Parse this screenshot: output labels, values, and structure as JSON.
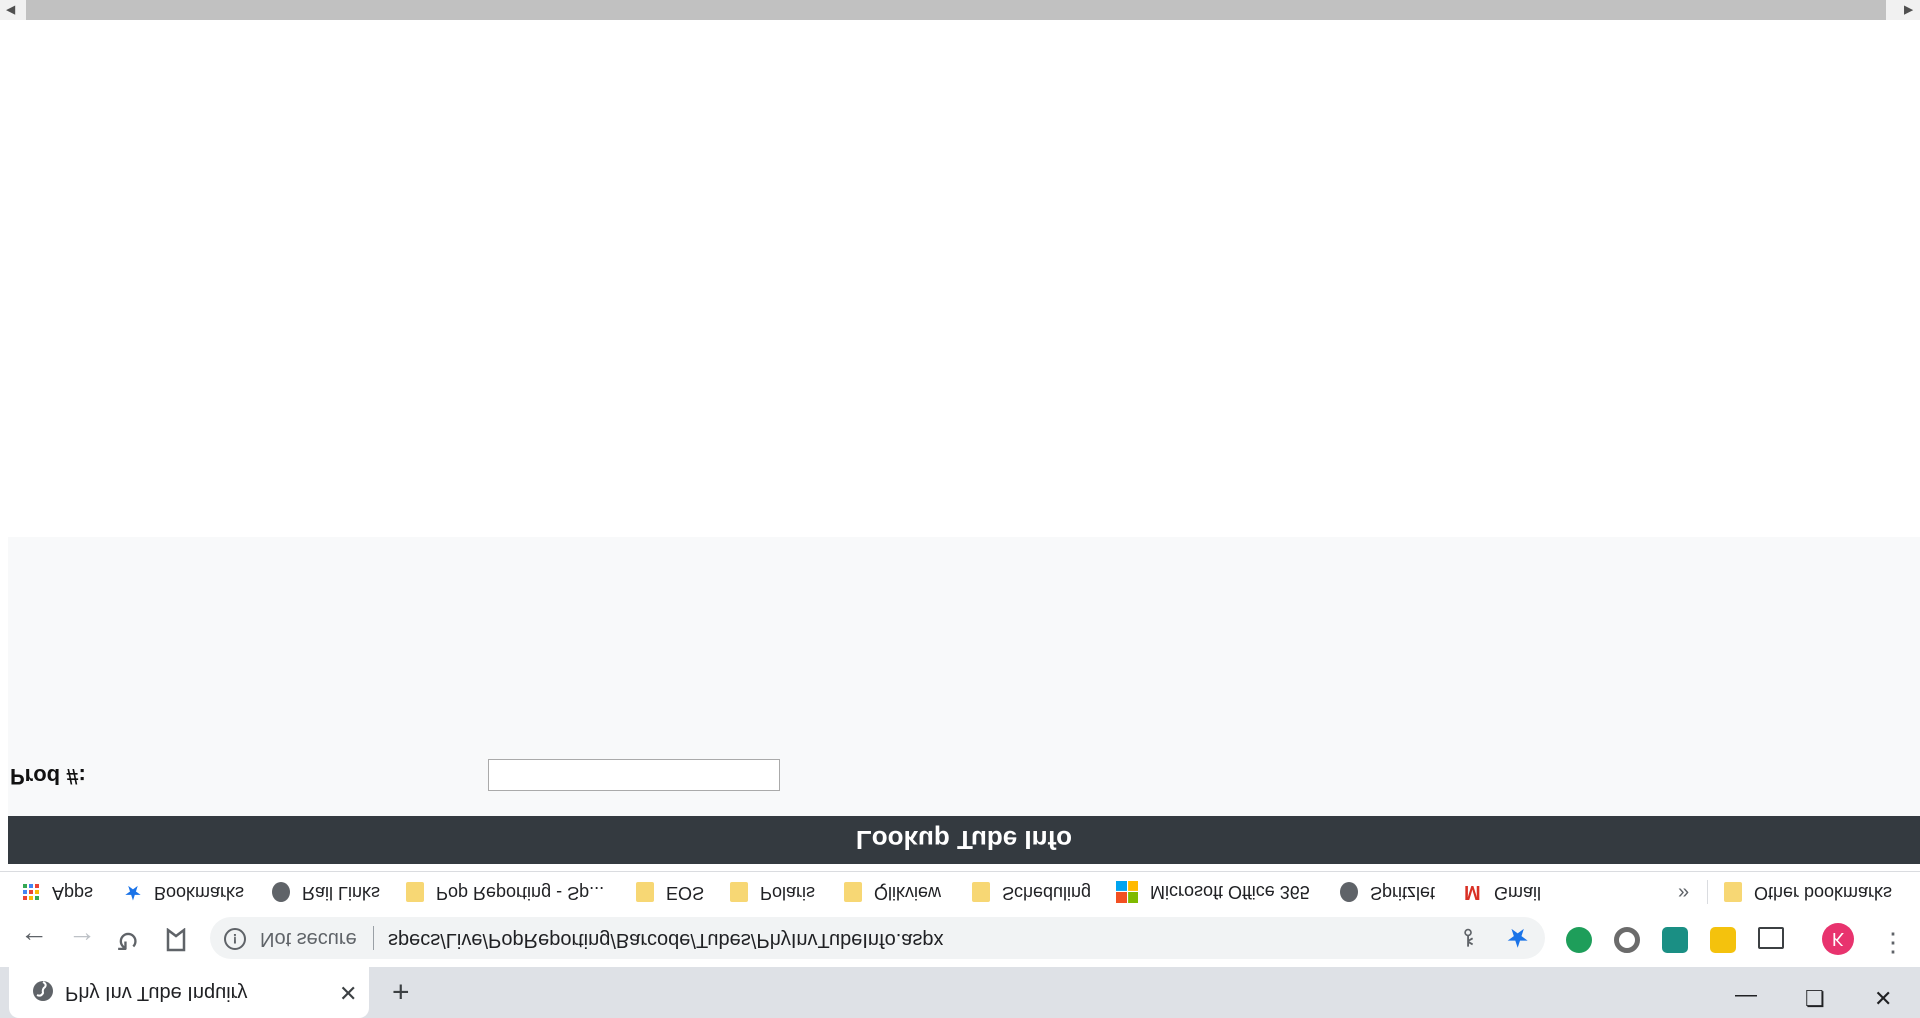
{
  "tab": {
    "title": "Phy Inv Tube Inquiry",
    "close_label": "✕",
    "new_tab_label": "+"
  },
  "window_controls": {
    "minimize": "—",
    "restore": "❐",
    "close": "✕"
  },
  "toolbar": {
    "back": "←",
    "forward": "→",
    "reload": "↻",
    "security_label": "Not secure",
    "url": "specs/Live/PopReporting/Barcode/Tubes/PhyInvTubeInfo.aspx",
    "profile_initial": "K",
    "menu": "⋮"
  },
  "bookmarks": {
    "items": [
      {
        "label": "Apps",
        "icon": "apps-grid-icon"
      },
      {
        "label": "Bookmarks",
        "icon": "star-icon"
      },
      {
        "label": "Rail Links",
        "icon": "globe-icon"
      },
      {
        "label": "Pop Reporting - Sp...",
        "icon": "folder-icon"
      },
      {
        "label": "EOS",
        "icon": "folder-icon"
      },
      {
        "label": "Polaris",
        "icon": "folder-icon"
      },
      {
        "label": "Qlikview",
        "icon": "folder-icon"
      },
      {
        "label": "Scheduling",
        "icon": "folder-icon"
      },
      {
        "label": "Microsoft Office 365",
        "icon": "ms-office-icon"
      },
      {
        "label": "Spritzlet",
        "icon": "globe-icon"
      },
      {
        "label": "Gmail",
        "icon": "gmail-icon"
      }
    ],
    "overflow": "»",
    "other_label": "Other bookmarks"
  },
  "page": {
    "lookup_title": "Lookup Tube Info",
    "prod_label": "Prod #:",
    "prod_value": ""
  },
  "colors": {
    "lookup_bar": "#343a40",
    "panel": "#f8f9fa",
    "avatar": "#e8336e",
    "star": "#1a73e8"
  }
}
